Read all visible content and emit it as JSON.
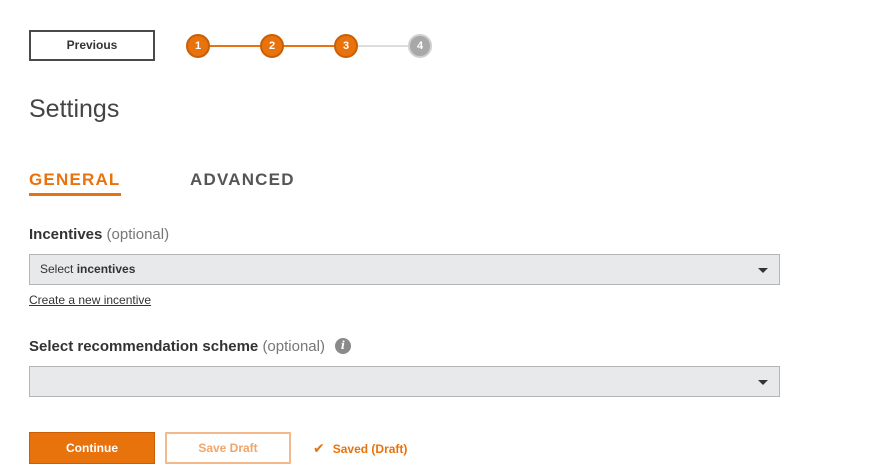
{
  "nav": {
    "previous_label": "Previous"
  },
  "stepper": {
    "steps": [
      {
        "label": "1",
        "state": "completed"
      },
      {
        "label": "2",
        "state": "completed"
      },
      {
        "label": "3",
        "state": "current"
      },
      {
        "label": "4",
        "state": "upcoming"
      }
    ],
    "active_color": "#e8720c",
    "inactive_color": "#a8a8a8"
  },
  "page": {
    "title": "Settings"
  },
  "tabs": [
    {
      "label": "GENERAL",
      "active": true
    },
    {
      "label": "ADVANCED",
      "active": false
    }
  ],
  "incentives": {
    "label": "Incentives",
    "optional": "(optional)",
    "select_prefix": "Select ",
    "select_bold": "incentives",
    "create_link": "Create a new incentive"
  },
  "recommendation": {
    "label": "Select recommendation scheme",
    "optional": "(optional)",
    "info_icon": "info-icon",
    "value": ""
  },
  "footer": {
    "continue_label": "Continue",
    "save_draft_label": "Save Draft",
    "saved_status": "Saved (Draft)",
    "saved_icon": "checkmark-icon"
  },
  "colors": {
    "accent": "#e8720c",
    "select_bg": "#e8e9ea"
  }
}
